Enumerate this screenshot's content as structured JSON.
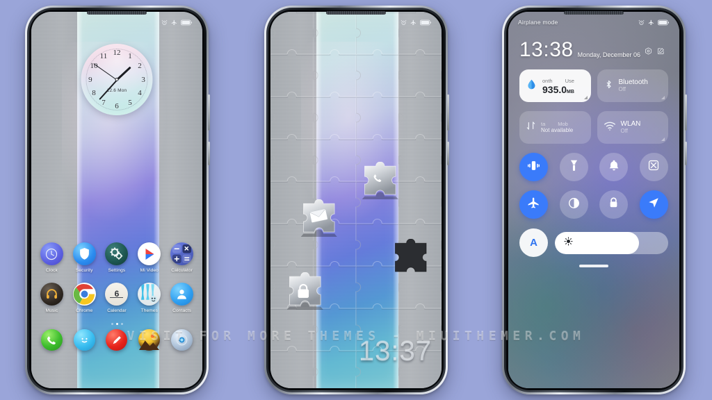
{
  "page": {
    "background_color": "#9aa5d9",
    "watermark": "VISIT FOR MORE THEMES - MIUITHEMER.COM"
  },
  "phone1": {
    "name": "home-screen",
    "statusbar": {
      "left_text": "",
      "icons": [
        "alarm-icon",
        "airplane-icon",
        "battery-icon"
      ]
    },
    "clock_widget": {
      "numerals": [
        "12",
        "1",
        "2",
        "3",
        "4",
        "5",
        "6",
        "7",
        "8",
        "9",
        "10",
        "11"
      ],
      "date_text": "12.6 Mon",
      "hour_deg": 47,
      "minute_deg": 222,
      "second_deg": 305
    },
    "apps_row1": [
      {
        "label": "Clock",
        "icon": "clock-icon"
      },
      {
        "label": "Security",
        "icon": "shield-icon"
      },
      {
        "label": "Settings",
        "icon": "gear-icon"
      },
      {
        "label": "Mi Video",
        "icon": "play-icon"
      },
      {
        "label": "Calculator",
        "icon": "calculator-icon"
      }
    ],
    "apps_row2": [
      {
        "label": "Music",
        "icon": "headphones-icon"
      },
      {
        "label": "Chrome",
        "icon": "chrome-icon"
      },
      {
        "label": "Calendar",
        "icon": "calendar-icon",
        "day": "6"
      },
      {
        "label": "Themes",
        "icon": "themes-icon"
      },
      {
        "label": "Contacts",
        "icon": "contacts-icon"
      }
    ],
    "page_dots": {
      "count": 3,
      "active_index": 1
    },
    "dock": [
      {
        "name": "phone-icon"
      },
      {
        "name": "messages-icon"
      },
      {
        "name": "notes-icon"
      },
      {
        "name": "gallery-icon"
      },
      {
        "name": "camera-icon"
      }
    ]
  },
  "phone2": {
    "name": "lock-screen",
    "statusbar": {
      "left_text": "",
      "icons": [
        "alarm-icon",
        "airplane-icon",
        "battery-icon"
      ]
    },
    "time": "13:37",
    "puzzle_pieces": [
      {
        "name": "phone-piece",
        "icon": "phone-handset-icon"
      },
      {
        "name": "mail-piece",
        "icon": "envelope-icon"
      },
      {
        "name": "unlock-piece",
        "icon": "lock-icon"
      },
      {
        "name": "empty-slot",
        "icon": "puzzle-hole-icon"
      }
    ]
  },
  "phone3": {
    "name": "control-center",
    "statusbar": {
      "left_text": "Airplane mode",
      "icons": [
        "alarm-icon",
        "airplane-icon",
        "battery-icon"
      ]
    },
    "time": "13:38",
    "date": "Monday, December 06",
    "date_icons": [
      "settings-circle-icon",
      "edit-icon"
    ],
    "big_tiles": [
      {
        "name": "data-usage-tile",
        "icon": "data-drop-icon",
        "top_left": "onth",
        "top_right": "Use",
        "value": "935.0",
        "unit": "MB",
        "state": "on"
      },
      {
        "name": "bluetooth-tile",
        "icon": "bluetooth-icon",
        "title": "Bluetooth",
        "subtitle": "Off",
        "state": "off"
      },
      {
        "name": "mobile-data-tile",
        "icon": "data-arrows-icon",
        "top_left": "ta",
        "top_right": "Mob",
        "subtitle": "Not available",
        "state": "off"
      },
      {
        "name": "wlan-tile",
        "icon": "wifi-icon",
        "title": "WLAN",
        "subtitle": "Off",
        "state": "off"
      }
    ],
    "toggle_row1": [
      {
        "name": "vibrate-toggle",
        "icon": "vibrate-icon",
        "state": "on"
      },
      {
        "name": "flashlight-toggle",
        "icon": "flashlight-icon",
        "state": "off"
      },
      {
        "name": "ringer-toggle",
        "icon": "bell-icon",
        "state": "off"
      },
      {
        "name": "screenshot-toggle",
        "icon": "screenshot-icon",
        "state": "off"
      }
    ],
    "toggle_row2": [
      {
        "name": "airplane-toggle",
        "icon": "airplane-icon",
        "state": "on"
      },
      {
        "name": "dark-mode-toggle",
        "icon": "contrast-icon",
        "state": "off"
      },
      {
        "name": "lock-toggle",
        "icon": "padlock-icon",
        "state": "off"
      },
      {
        "name": "location-toggle",
        "icon": "location-icon",
        "state": "on"
      }
    ],
    "brightness": {
      "auto_label": "A",
      "auto_name": "auto-brightness-button",
      "slider_name": "brightness-slider",
      "fill_percent": 74,
      "icon": "sun-icon"
    }
  },
  "colors": {
    "accent_blue": "#3a7bfa",
    "tile_light": "#ffffff",
    "background": "#9aa5d9"
  }
}
